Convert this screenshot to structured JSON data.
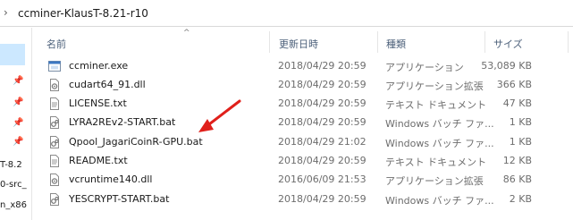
{
  "address": {
    "path": "ccminer-KlausT-8.21-r10"
  },
  "nav": {
    "labels": [
      "T-8.2",
      "0-src_",
      "n_x86"
    ]
  },
  "columns": {
    "name": "名前",
    "date": "更新日時",
    "type": "種類",
    "size": "サイズ"
  },
  "files": [
    {
      "name": "ccminer.exe",
      "date": "2018/04/29 20:59",
      "type": "アプリケーション",
      "size": "53,089 KB",
      "icon": "exe-icon"
    },
    {
      "name": "cudart64_91.dll",
      "date": "2018/04/29 20:59",
      "type": "アプリケーション拡張",
      "size": "366 KB",
      "icon": "dll-icon"
    },
    {
      "name": "LICENSE.txt",
      "date": "2018/04/29 20:59",
      "type": "テキスト ドキュメント",
      "size": "47 KB",
      "icon": "text-file-icon"
    },
    {
      "name": "LYRA2REv2-START.bat",
      "date": "2018/04/29 20:59",
      "type": "Windows バッチ ファ...",
      "size": "1 KB",
      "icon": "batch-file-icon"
    },
    {
      "name": "Qpool_JagariCoinR-GPU.bat",
      "date": "2018/04/29 21:02",
      "type": "Windows バッチ ファ...",
      "size": "1 KB",
      "icon": "batch-file-icon"
    },
    {
      "name": "README.txt",
      "date": "2018/04/29 20:59",
      "type": "テキスト ドキュメント",
      "size": "12 KB",
      "icon": "text-file-icon"
    },
    {
      "name": "vcruntime140.dll",
      "date": "2016/06/09 21:53",
      "type": "アプリケーション拡張",
      "size": "86 KB",
      "icon": "dll-icon"
    },
    {
      "name": "YESCRYPT-START.bat",
      "date": "2018/04/29 20:59",
      "type": "Windows バッチ ファ...",
      "size": "2 KB",
      "icon": "batch-file-icon"
    }
  ],
  "annotation": {
    "color": "#e0201b"
  }
}
